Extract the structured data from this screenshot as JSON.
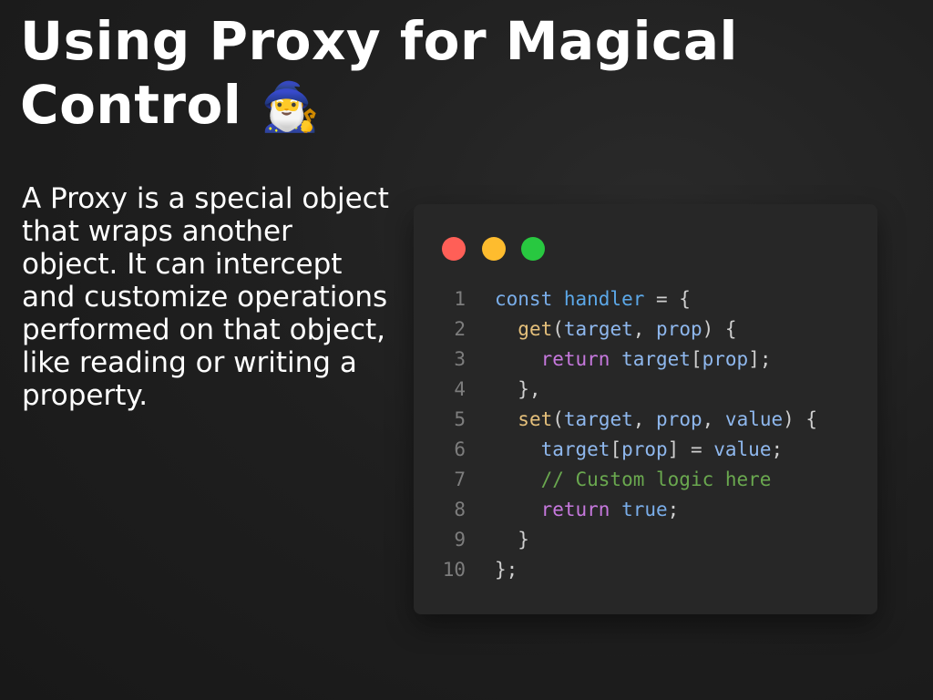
{
  "slide": {
    "title": "Using Proxy for Magical Control",
    "title_emoji": "🧙‍♂️",
    "description": "A Proxy is a special object that wraps another object. It can intercept and customize operations performed on that object, like reading or writing a property."
  },
  "colors": {
    "background": "#1f1f1f",
    "code_window": "#272727",
    "dot_red": "#ff5f57",
    "dot_yellow": "#febc2e",
    "dot_green": "#28c840"
  },
  "code_window": {
    "controls": [
      "close-dot",
      "minimize-dot",
      "maximize-dot"
    ],
    "lines": [
      {
        "n": "1",
        "tokens": [
          {
            "t": "const ",
            "k": "kwb"
          },
          {
            "t": "handler",
            "k": "var"
          },
          {
            "t": " = {",
            "k": "punc"
          }
        ]
      },
      {
        "n": "2",
        "tokens": [
          {
            "t": "  ",
            "k": "punc"
          },
          {
            "t": "get",
            "k": "fn"
          },
          {
            "t": "(",
            "k": "punc"
          },
          {
            "t": "target",
            "k": "id"
          },
          {
            "t": ", ",
            "k": "punc"
          },
          {
            "t": "prop",
            "k": "id"
          },
          {
            "t": ") {",
            "k": "punc"
          }
        ]
      },
      {
        "n": "3",
        "tokens": [
          {
            "t": "    ",
            "k": "punc"
          },
          {
            "t": "return ",
            "k": "kw"
          },
          {
            "t": "target",
            "k": "id"
          },
          {
            "t": "[",
            "k": "punc"
          },
          {
            "t": "prop",
            "k": "id"
          },
          {
            "t": "];",
            "k": "punc"
          }
        ]
      },
      {
        "n": "4",
        "tokens": [
          {
            "t": "  },",
            "k": "punc"
          }
        ]
      },
      {
        "n": "5",
        "tokens": [
          {
            "t": "  ",
            "k": "punc"
          },
          {
            "t": "set",
            "k": "fn"
          },
          {
            "t": "(",
            "k": "punc"
          },
          {
            "t": "target",
            "k": "id"
          },
          {
            "t": ", ",
            "k": "punc"
          },
          {
            "t": "prop",
            "k": "id"
          },
          {
            "t": ", ",
            "k": "punc"
          },
          {
            "t": "value",
            "k": "id"
          },
          {
            "t": ") {",
            "k": "punc"
          }
        ]
      },
      {
        "n": "6",
        "tokens": [
          {
            "t": "    ",
            "k": "punc"
          },
          {
            "t": "target",
            "k": "id"
          },
          {
            "t": "[",
            "k": "punc"
          },
          {
            "t": "prop",
            "k": "id"
          },
          {
            "t": "] = ",
            "k": "punc"
          },
          {
            "t": "value",
            "k": "id"
          },
          {
            "t": ";",
            "k": "punc"
          }
        ]
      },
      {
        "n": "7",
        "tokens": [
          {
            "t": "    ",
            "k": "punc"
          },
          {
            "t": "// Custom logic here",
            "k": "cmt"
          }
        ]
      },
      {
        "n": "8",
        "tokens": [
          {
            "t": "    ",
            "k": "punc"
          },
          {
            "t": "return ",
            "k": "kw"
          },
          {
            "t": "true",
            "k": "kwb"
          },
          {
            "t": ";",
            "k": "punc"
          }
        ]
      },
      {
        "n": "9",
        "tokens": [
          {
            "t": "  }",
            "k": "punc"
          }
        ]
      },
      {
        "n": "10",
        "tokens": [
          {
            "t": "};",
            "k": "punc"
          }
        ]
      }
    ]
  }
}
